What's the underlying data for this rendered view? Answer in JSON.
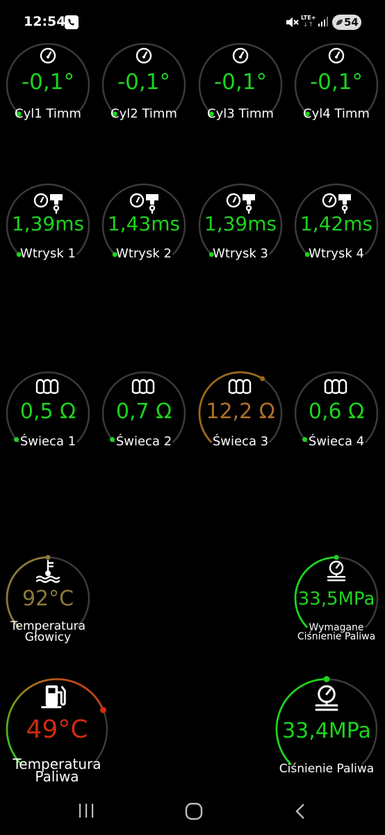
{
  "status_bar": {
    "time": "12:54",
    "network": "LTE+",
    "battery": "54",
    "icons": [
      "whatsapp-icon",
      "mute-icon",
      "signal-icon",
      "battery-icon"
    ]
  },
  "colors": {
    "green": "#1ed31e",
    "orange": "#b0702a",
    "olive": "#8a7a3a",
    "red": "#d02a10",
    "ring": "#3a3a3a"
  },
  "gauges": [
    {
      "id": "cyl1",
      "value": "-0,1°",
      "label": "Cyl1 Timm",
      "icon": "gauge-icon",
      "level": 0.0,
      "color": "green"
    },
    {
      "id": "cyl2",
      "value": "-0,1°",
      "label": "Cyl2 Timm",
      "icon": "gauge-icon",
      "level": 0.0,
      "color": "green"
    },
    {
      "id": "cyl3",
      "value": "-0,1°",
      "label": "Cyl3 Timm",
      "icon": "gauge-icon",
      "level": 0.0,
      "color": "green"
    },
    {
      "id": "cyl4",
      "value": "-0,1°",
      "label": "Cyl4 Timm",
      "icon": "gauge-icon",
      "level": 0.0,
      "color": "green"
    },
    {
      "id": "inj1",
      "value": "1,39ms",
      "label": "Wtrysk 1",
      "icon": "injector-icon",
      "level": 0.0,
      "color": "green"
    },
    {
      "id": "inj2",
      "value": "1,43ms",
      "label": "Wtrysk 2",
      "icon": "injector-icon",
      "level": 0.0,
      "color": "green"
    },
    {
      "id": "inj3",
      "value": "1,39ms",
      "label": "Wtrysk 3",
      "icon": "injector-icon",
      "level": 0.0,
      "color": "green"
    },
    {
      "id": "inj4",
      "value": "1,42ms",
      "label": "Wtrysk 4",
      "icon": "injector-icon",
      "level": 0.0,
      "color": "green"
    },
    {
      "id": "glow1",
      "value": "0,5 Ω",
      "label": "Świeca 1",
      "icon": "glow-plug-icon",
      "level": 0.02,
      "color": "green"
    },
    {
      "id": "glow2",
      "value": "0,7 Ω",
      "label": "Świeca 2",
      "icon": "glow-plug-icon",
      "level": 0.02,
      "color": "green"
    },
    {
      "id": "glow3",
      "value": "12,2 Ω",
      "label": "Świeca 3",
      "icon": "glow-plug-icon",
      "level": 0.62,
      "color": "orange"
    },
    {
      "id": "glow4",
      "value": "0,6 Ω",
      "label": "Świeca 4",
      "icon": "glow-plug-icon",
      "level": 0.02,
      "color": "green"
    },
    {
      "id": "head_temp",
      "value": "92°C",
      "label": [
        "Temperatura",
        "Głowicy"
      ],
      "icon": "coolant-temp-icon",
      "level": 0.5,
      "color": "olive"
    },
    {
      "id": "req_pressure",
      "value": "33,5MPa",
      "label": [
        "Wymagane",
        "Ciśnienie Paliwa"
      ],
      "icon": "pressure-gauge-icon",
      "level": 0.5,
      "color": "green"
    },
    {
      "id": "fuel_temp",
      "value": "49°C",
      "label": [
        "Temperatura",
        "Paliwa"
      ],
      "icon": "fuel-temp-icon",
      "level": 0.75,
      "color": "red"
    },
    {
      "id": "fuel_pressure",
      "value": "33,4MPa",
      "label": "Ciśnienie Paliwa",
      "icon": "pressure-gauge-icon",
      "level": 0.5,
      "color": "green"
    }
  ],
  "nav": [
    "recent-apps-icon",
    "home-icon",
    "back-icon"
  ]
}
